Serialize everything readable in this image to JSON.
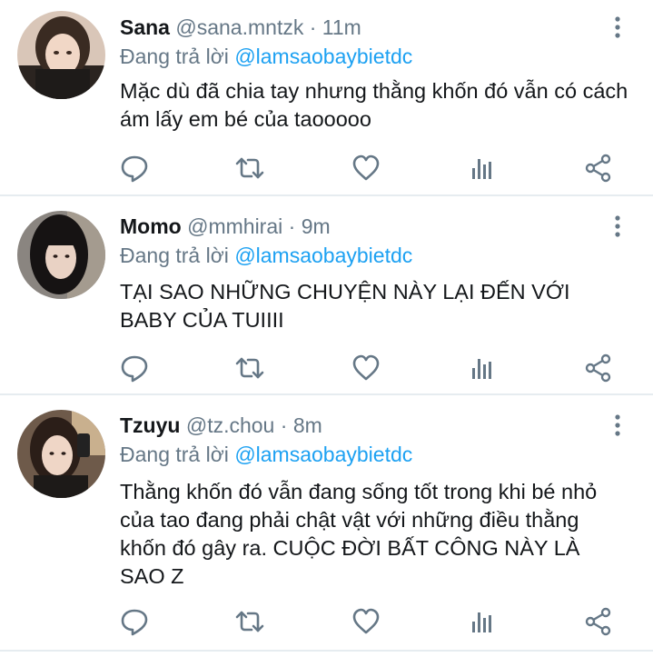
{
  "tweets": [
    {
      "name": "Sana",
      "handle": "@sana.mntzk",
      "dot": "·",
      "time": "11m",
      "reply_prefix": "Đang trả lời",
      "reply_to": "@lamsaobaybietdc",
      "text": "Mặc dù đã chia tay nhưng thằng khốn đó vẫn có cách ám lấy em bé của taooooo"
    },
    {
      "name": "Momo",
      "handle": "@mmhirai",
      "dot": "·",
      "time": "9m",
      "reply_prefix": "Đang trả lời",
      "reply_to": "@lamsaobaybietdc",
      "text": "TẠI SAO NHỮNG CHUYỆN NÀY LẠI ĐẾN VỚI BABY CỦA TUIIII"
    },
    {
      "name": "Tzuyu",
      "handle": "@tz.chou",
      "dot": "·",
      "time": "8m",
      "reply_prefix": "Đang trả lời",
      "reply_to": "@lamsaobaybietdc",
      "text": "Thằng khốn đó vẫn đang sống tốt trong khi bé nhỏ của tao đang phải chật vật với những điều thằng khốn đó gây ra. CUỘC ĐỜI BẤT CÔNG NÀY LÀ SAO Z"
    }
  ],
  "icons": {
    "reply": "comment-icon",
    "retweet": "retweet-icon",
    "like": "heart-icon",
    "stats": "bar-chart-icon",
    "share": "share-icon",
    "more": "vertical-dots-icon"
  },
  "colors": {
    "name": "#14171a",
    "muted": "#657786",
    "mention": "#1da1f2",
    "divider": "#e6ecf0"
  }
}
